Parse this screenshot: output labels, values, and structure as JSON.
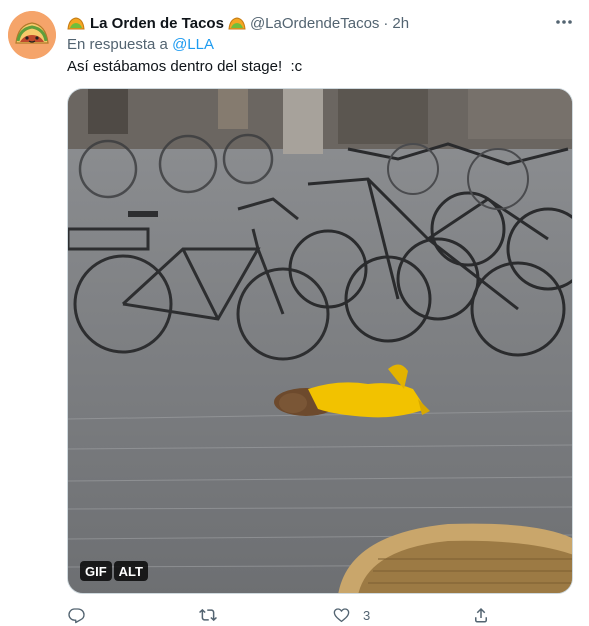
{
  "tweet": {
    "display_name": "La Orden de Tacos",
    "handle": "@LaOrdendeTacos",
    "separator": "·",
    "timestamp": "2h",
    "reply_prefix": "En respuesta a",
    "reply_to": "@LLA",
    "text": "Así estábamos dentro del stage!  :c",
    "media": {
      "gif_badge": "GIF",
      "alt_badge": "ALT"
    },
    "actions": {
      "reply_icon": "reply-icon",
      "retweet_icon": "retweet-icon",
      "like_icon": "heart-icon",
      "like_count": "3",
      "share_icon": "share-icon"
    }
  },
  "colors": {
    "accent": "#1d9bf0",
    "secondary_text": "#536471",
    "primary_text": "#0f1419",
    "avatar_bg": "#f5a46a",
    "taco_emoji": "#f4a623"
  }
}
